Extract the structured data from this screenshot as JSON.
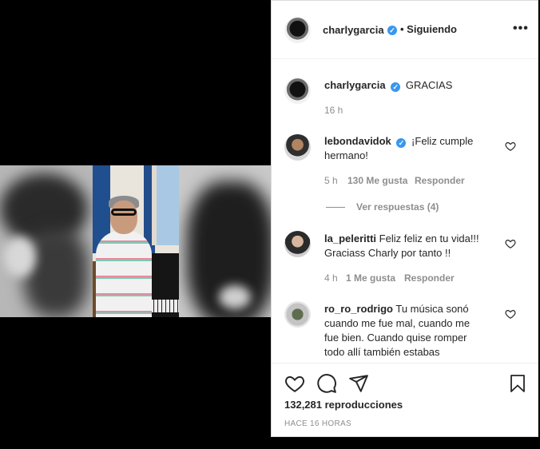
{
  "post": {
    "author": "charlygarcia",
    "follow_status": "• Siguiendo",
    "more_label": "•••"
  },
  "caption": {
    "username": "charlygarcia",
    "text": "GRACIAS",
    "time": "16 h"
  },
  "comments": [
    {
      "username": "lebondavidok",
      "verified": true,
      "text_line1": "¡Feliz cumple",
      "text_line2": "hermano!",
      "time": "5 h",
      "likes": "130 Me gusta",
      "reply": "Responder",
      "view_replies": "Ver respuestas (4)"
    },
    {
      "username": "la_peleritti",
      "text_line1": "Feliz feliz en tu vida!!!",
      "text_line2": "Graciass Charly por tanto !!",
      "time": "4 h",
      "likes": "1 Me gusta",
      "reply": "Responder"
    },
    {
      "username": "ro_ro_rodrigo",
      "text_line1": "Tu música sonó",
      "text_line2": "cuando me fue mal, cuando me",
      "text_line3": "fue bien. Cuando quise romper",
      "text_line4": "todo allí también estabas"
    }
  ],
  "actions": {
    "like_icon": "heart-icon",
    "comment_icon": "comment-icon",
    "share_icon": "share-icon",
    "save_icon": "bookmark-icon",
    "views": "132,281 reproducciones",
    "posted": "HACE 16 HORAS"
  },
  "colors": {
    "verified": "#3897f0",
    "muted": "#8e8e8e",
    "text": "#262626"
  }
}
